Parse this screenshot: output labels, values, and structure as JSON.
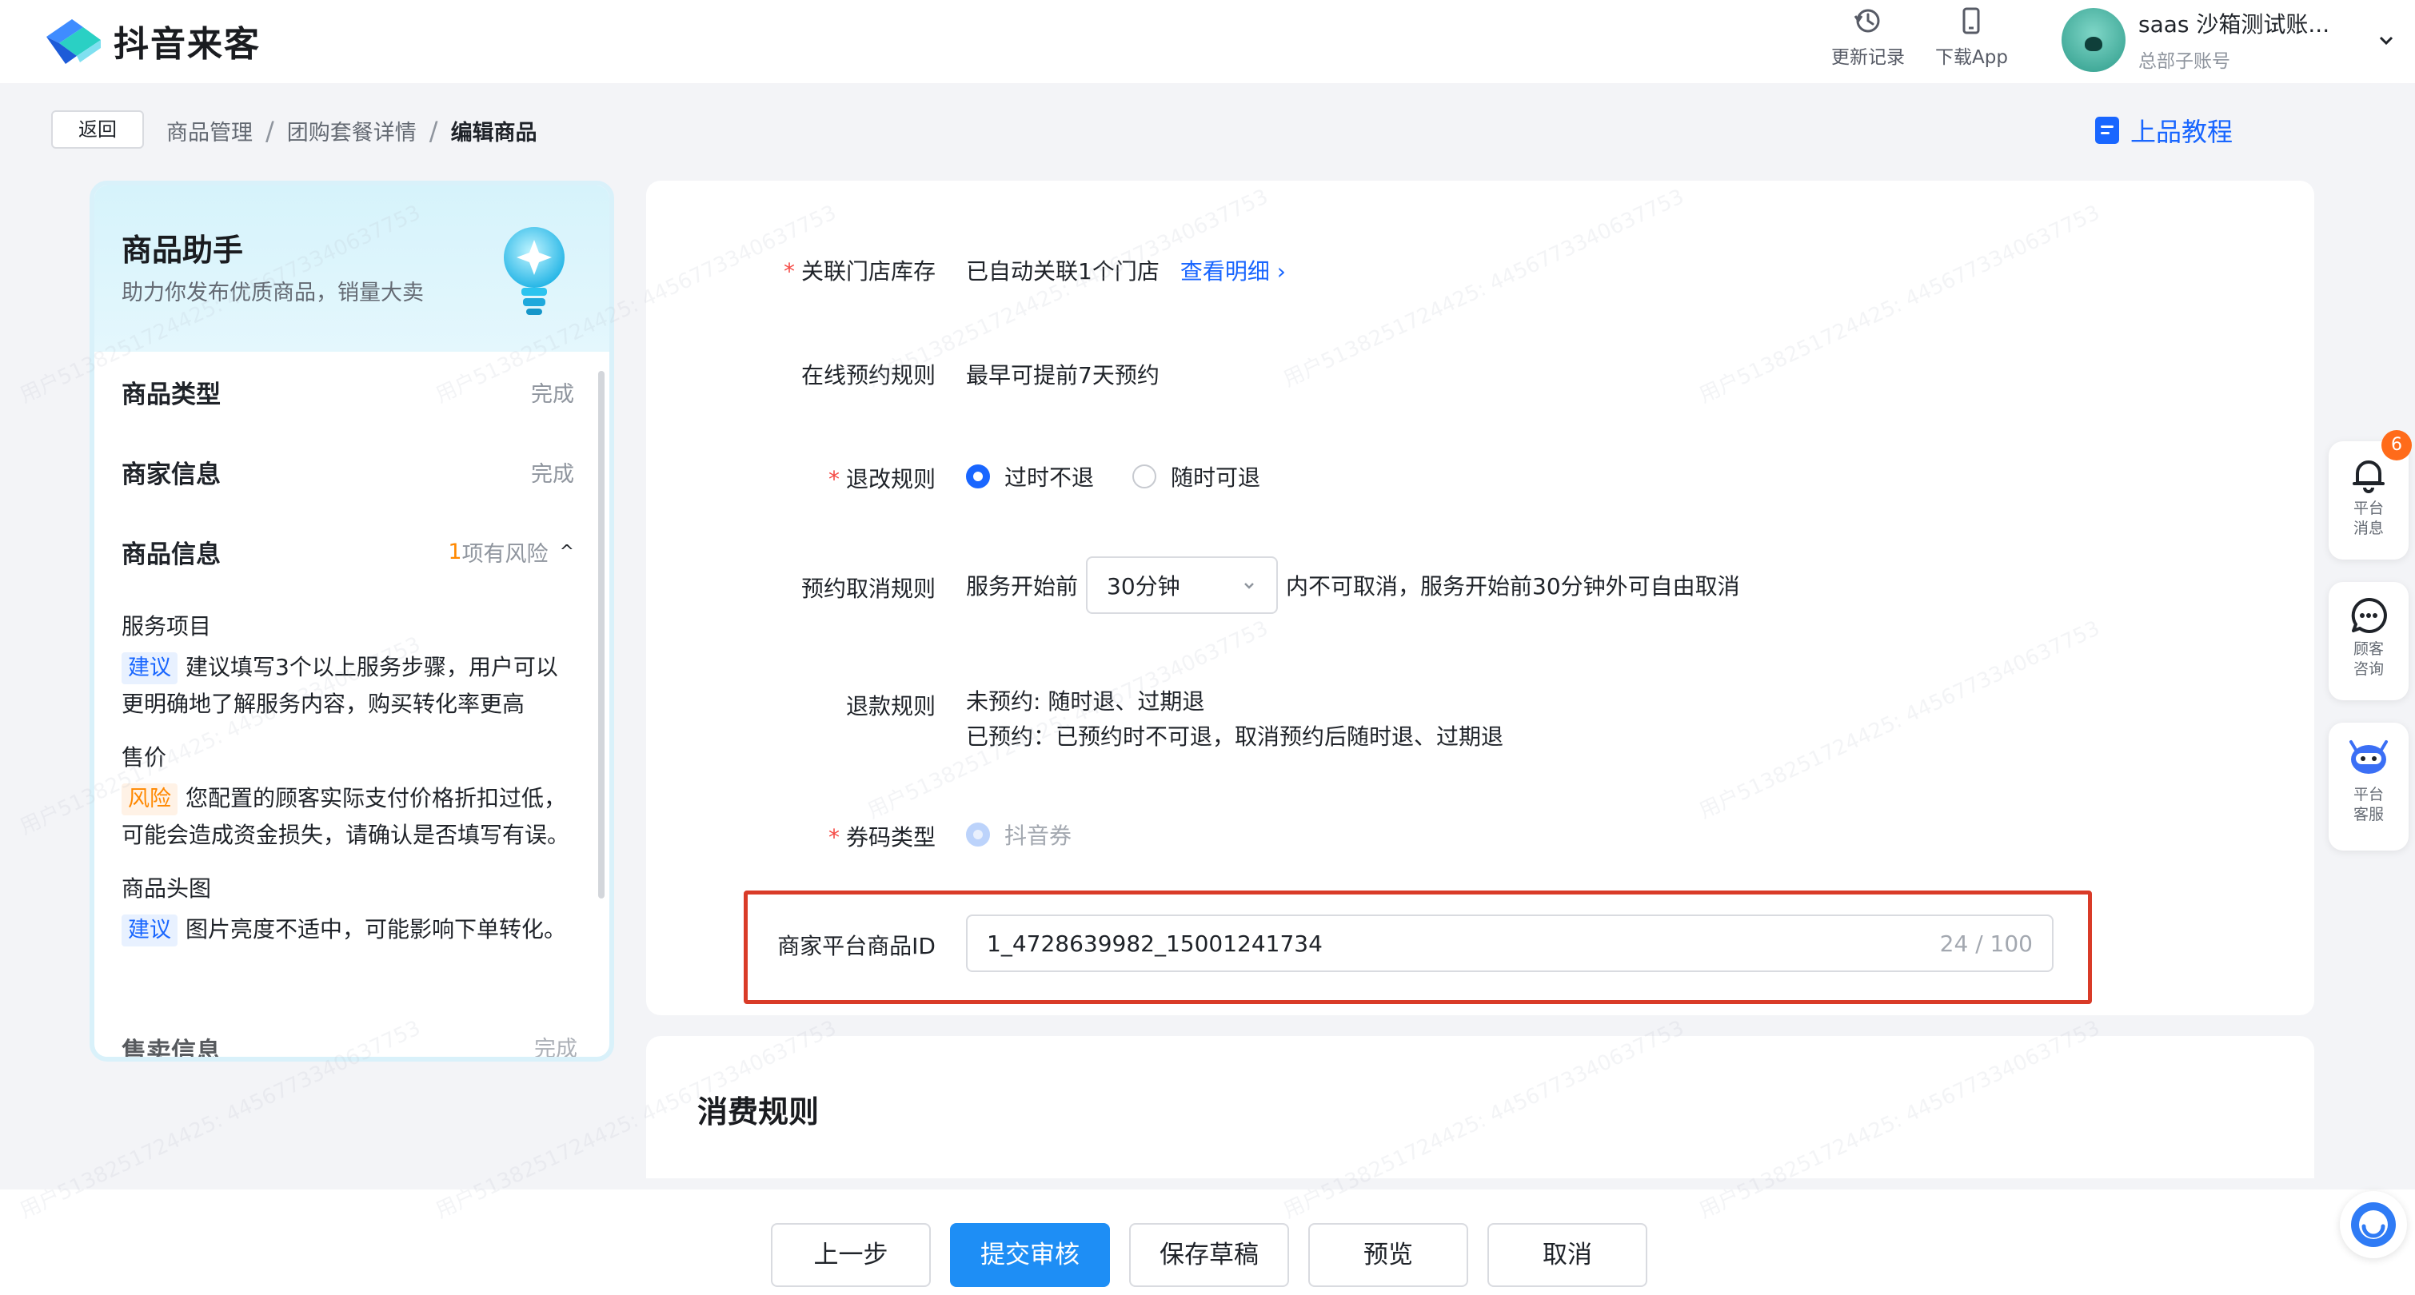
{
  "app": {
    "logo_text": "抖音来客"
  },
  "header": {
    "tools": [
      {
        "label": "更新记录",
        "icon": "history-icon"
      },
      {
        "label": "下载App",
        "icon": "phone-icon"
      }
    ],
    "user": {
      "name": "saas 沙箱测试账...",
      "role": "总部子账号"
    }
  },
  "breadcrumb": {
    "back_label": "返回",
    "items": [
      "商品管理",
      "团购套餐详情",
      "编辑商品"
    ],
    "separator": "/",
    "tutorial_label": "上品教程"
  },
  "assistant": {
    "title": "商品助手",
    "subtitle": "助力你发布优质商品，销量大卖",
    "steps": [
      {
        "title": "商品类型",
        "status": "完成"
      },
      {
        "title": "商家信息",
        "status": "完成"
      },
      {
        "title": "商品信息",
        "risk_count": "1",
        "risk_text": "项有风险",
        "expand_icon": "^"
      }
    ],
    "details": [
      {
        "title": "服务项目",
        "tag": "建议",
        "tag_type": "suggest",
        "text": "建议填写3个以上服务步骤，用户可以更明确地了解服务内容，购买转化率更高"
      },
      {
        "title": "售价",
        "tag": "风险",
        "tag_type": "risk",
        "text": "您配置的顾客实际支付价格折扣过低，可能会造成资金损失，请确认是否填写有误。"
      },
      {
        "title": "商品头图",
        "tag": "建议",
        "tag_type": "suggest",
        "text": "图片亮度不适中，可能影响下单转化。"
      }
    ],
    "partial_step": {
      "title": "售卖信息",
      "status": "完成"
    }
  },
  "form": {
    "store_stock": {
      "label": "关联门店库存",
      "required": true,
      "value": "已自动关联1个门店",
      "link": "查看明细",
      "link_arrow": "›"
    },
    "booking_rule": {
      "label": "在线预约规则",
      "value": "最早可提前7天预约"
    },
    "refund_change": {
      "label": "退改规则",
      "required": true,
      "options": [
        "过时不退",
        "随时可退"
      ],
      "selected": "过时不退"
    },
    "cancel_rule": {
      "label": "预约取消规则",
      "prefix": "服务开始前",
      "select_value": "30分钟",
      "suffix": "内不可取消，服务开始前30分钟外可自由取消"
    },
    "refund_rule": {
      "label": "退款规则",
      "line1": "未预约: 随时退、过期退",
      "line2": "已预约：已预约时不可退，取消预约后随时退、过期退"
    },
    "coupon_type": {
      "label": "券码类型",
      "required": true,
      "value": "抖音券"
    },
    "merchant_id": {
      "label": "商家平台商品ID",
      "value": "1_4728639982_15001241734",
      "count": "24",
      "max": "100",
      "count_sep": "/"
    }
  },
  "consume_section": {
    "title": "消费规则"
  },
  "actions": {
    "prev": "上一步",
    "submit": "提交审核",
    "save_draft": "保存草稿",
    "preview": "预览",
    "cancel": "取消"
  },
  "dock": {
    "messages": {
      "label1": "平台",
      "label2": "消息",
      "badge": "6"
    },
    "consult": {
      "label1": "顾客",
      "label2": "咨询"
    },
    "service": {
      "label1": "平台",
      "label2": "客服"
    }
  },
  "watermark": "用户5138251724425: 4456773340637753",
  "colors": {
    "primary": "#1966ff",
    "submit": "#1e8ef5",
    "required": "#f54a45",
    "risk": "#ff8800",
    "highlight_frame": "#d93b28"
  }
}
